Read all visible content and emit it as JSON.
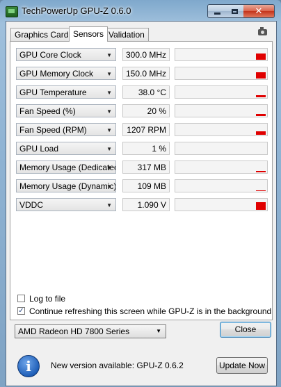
{
  "window": {
    "title": "TechPowerUp GPU-Z 0.6.0",
    "close_glyph": "✕"
  },
  "tabs": [
    {
      "label": "Graphics Card",
      "active": false
    },
    {
      "label": "Sensors",
      "active": true
    },
    {
      "label": "Validation",
      "active": false
    }
  ],
  "sensors": [
    {
      "name": "GPU Core Clock",
      "value": "300.0 MHz",
      "level": 0.55
    },
    {
      "name": "GPU Memory Clock",
      "value": "150.0 MHz",
      "level": 0.55
    },
    {
      "name": "GPU Temperature",
      "value": "38.0 °C",
      "level": 0.15
    },
    {
      "name": "Fan Speed (%)",
      "value": "20 %",
      "level": 0.15
    },
    {
      "name": "Fan Speed (RPM)",
      "value": "1207 RPM",
      "level": 0.3
    },
    {
      "name": "GPU Load",
      "value": "1 %",
      "level": 0.0
    },
    {
      "name": "Memory Usage (Dedicated)",
      "value": "317 MB",
      "level": 0.1
    },
    {
      "name": "Memory Usage (Dynamic)",
      "value": "109 MB",
      "level": 0.05
    },
    {
      "name": "VDDC",
      "value": "1.090 V",
      "level": 0.65
    }
  ],
  "options": {
    "log_to_file": {
      "label": "Log to file",
      "checked": false
    },
    "continue_refresh": {
      "label": "Continue refreshing this screen while GPU-Z is in the background",
      "checked": true
    }
  },
  "gpu_selector": {
    "selected": "AMD Radeon HD 7800 Series"
  },
  "buttons": {
    "close": "Close",
    "update_now": "Update Now"
  },
  "update": {
    "message": "New version available: GPU-Z 0.6.2",
    "icon": "info-icon"
  },
  "colors": {
    "graph_bar": "#e00000",
    "window_frame": "#8fb3d3"
  }
}
